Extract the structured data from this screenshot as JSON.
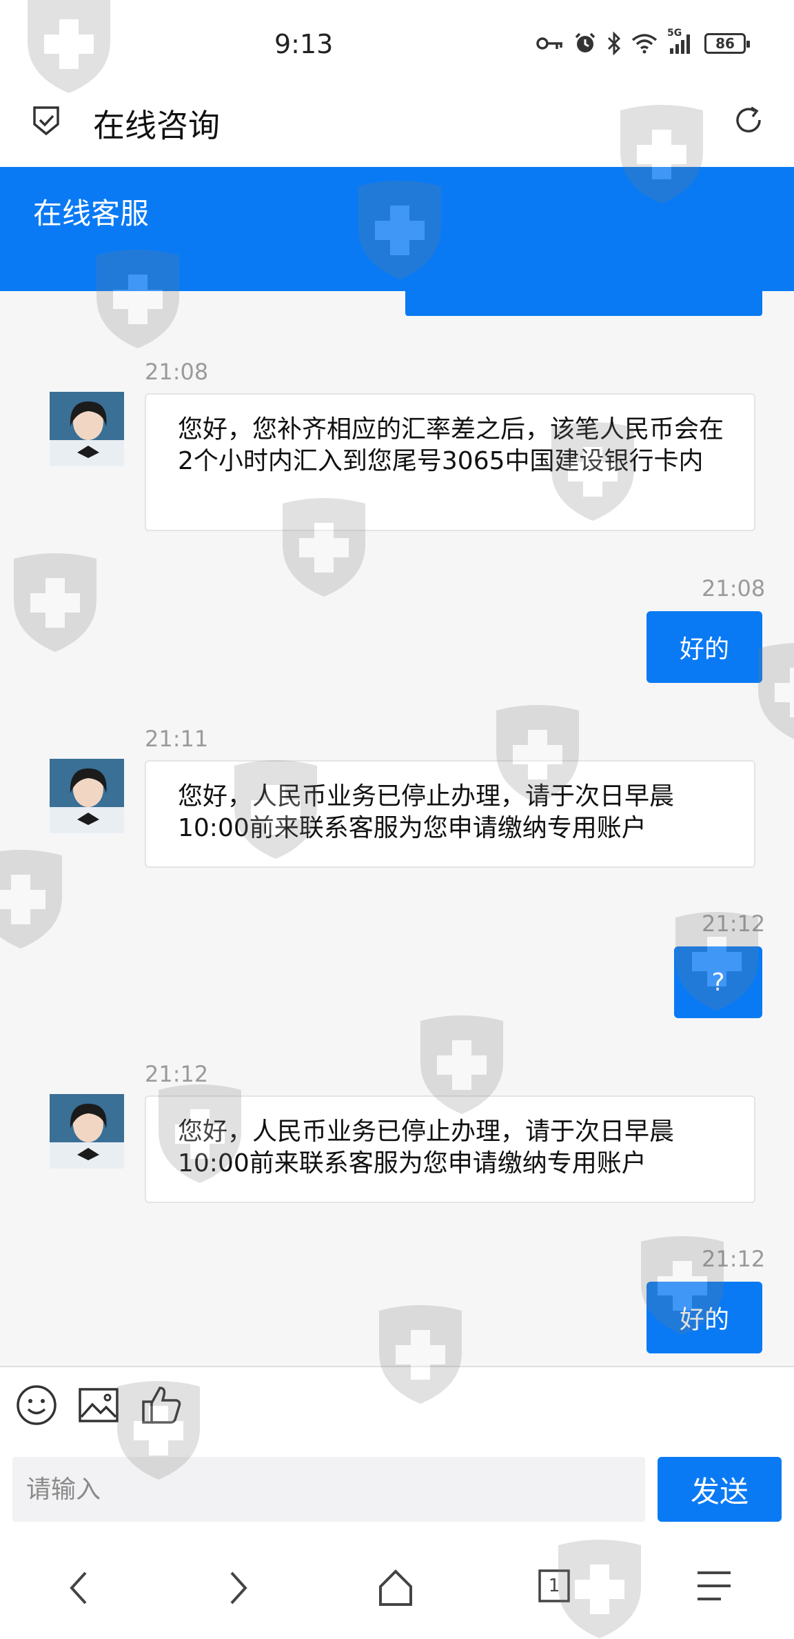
{
  "status_bar": {
    "time": "9:13",
    "signal_label": "5G",
    "battery": "86",
    "icons": [
      "key-icon",
      "alarm-icon",
      "bluetooth-icon",
      "wifi-icon",
      "signal-icon",
      "battery-icon"
    ]
  },
  "title_bar": {
    "title": "在线咨询",
    "left_icon": "shield-check-icon",
    "right_icon": "refresh-icon"
  },
  "service_header": {
    "title": "在线客服",
    "accent_color": "#0a7af4"
  },
  "messages": [
    {
      "side": "agent",
      "time": "21:08",
      "text": "您好，您补齐相应的汇率差之后，该笔人民币会在2个小时内汇入到您尾号3065中国建设银行卡内"
    },
    {
      "side": "user",
      "time": "21:08",
      "text": "好的"
    },
    {
      "side": "agent",
      "time": "21:11",
      "text": "您好，人民币业务已停止办理，请于次日早晨10:00前来联系客服为您申请缴纳专用账户"
    },
    {
      "side": "user",
      "time": "21:12",
      "text": "?"
    },
    {
      "side": "agent",
      "time": "21:12",
      "text": "您好，人民币业务已停止办理，请于次日早晨10:00前来联系客服为您申请缴纳专用账户"
    },
    {
      "side": "user",
      "time": "21:12",
      "text": "好的"
    }
  ],
  "input_area": {
    "tools": [
      "emoji-icon",
      "image-icon",
      "thumbs-up-icon"
    ],
    "placeholder": "请输入",
    "send_label": "发送"
  },
  "nav_bar": {
    "items": [
      "back-icon",
      "forward-icon",
      "home-icon",
      "tabs-icon",
      "menu-icon"
    ],
    "tab_count": "1"
  }
}
